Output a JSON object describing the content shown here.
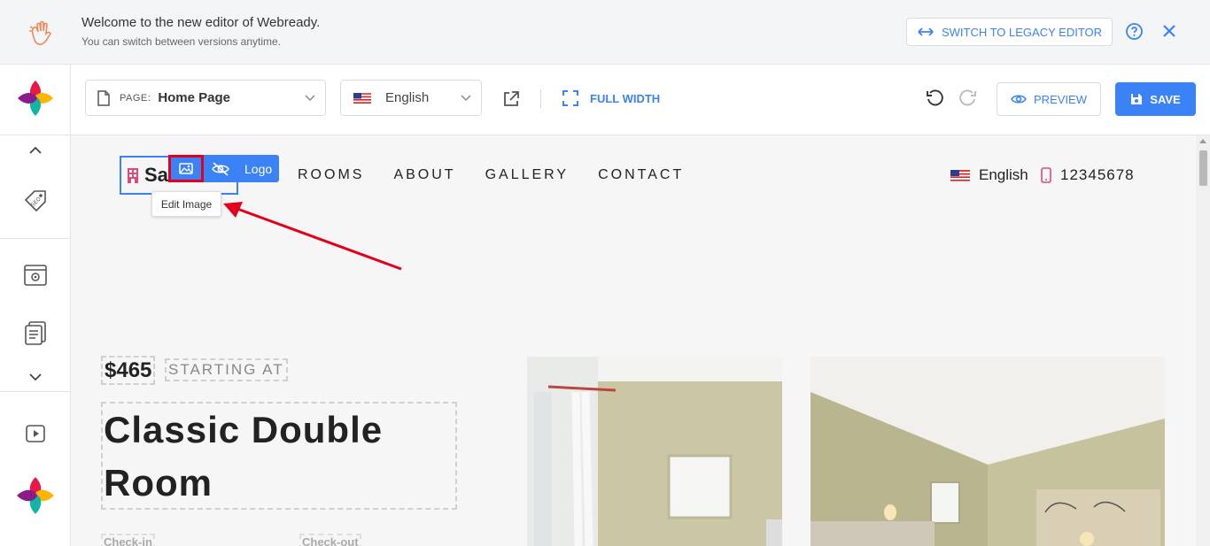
{
  "banner": {
    "title": "Welcome to the new editor of Webready.",
    "subtitle": "You can switch between versions anytime.",
    "legacy_button": "SWITCH TO LEGACY EDITOR"
  },
  "toolbar": {
    "page_label": "PAGE:",
    "page_value": "Home Page",
    "language": "English",
    "full_width": "FULL WIDTH",
    "preview": "PREVIEW",
    "save": "SAVE"
  },
  "site": {
    "logo_text": "Sa",
    "logo_toolbar_label": "Logo",
    "tooltip": "Edit Image",
    "nav": [
      "ROOMS",
      "ABOUT",
      "GALLERY",
      "CONTACT"
    ],
    "language": "English",
    "phone": "12345678",
    "price": "$465",
    "starting_at": "STARTING AT",
    "room_title_line1": "Classic Double",
    "room_title_line2": "Room",
    "check_in": "Check-in",
    "check_out": "Check-out"
  },
  "colors": {
    "accent": "#3b82f6",
    "highlight": "#e3001b",
    "canvas_bg": "#f6f6f6"
  }
}
